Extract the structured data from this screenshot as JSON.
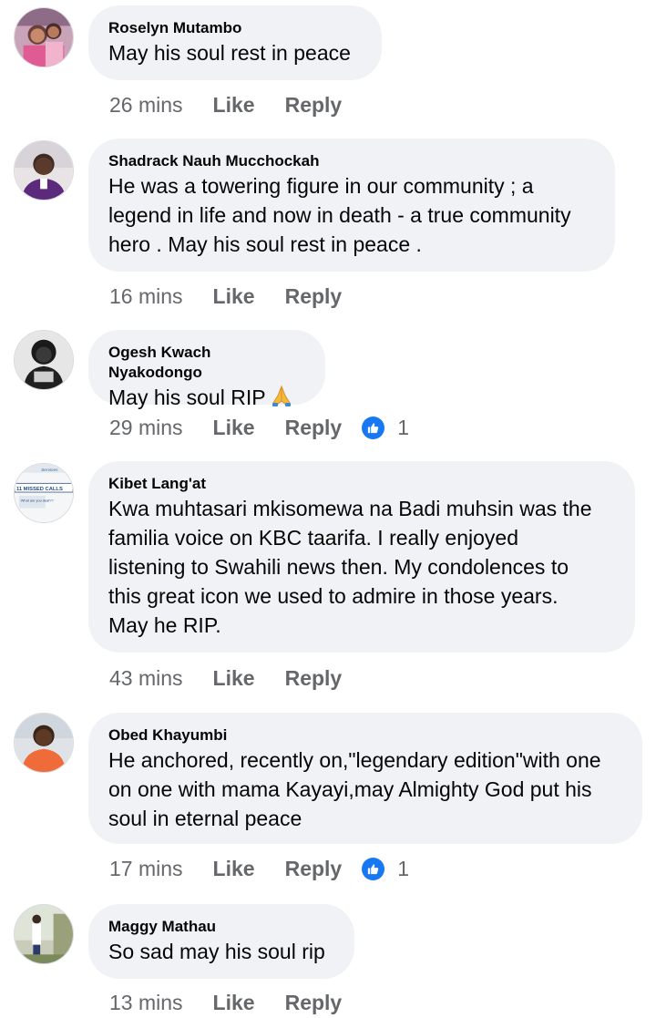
{
  "colors": {
    "bubble_bg": "#f0f2f5",
    "meta_text": "#65676b",
    "like_badge": "#1877f2",
    "text": "#050505"
  },
  "labels": {
    "like": "Like",
    "reply": "Reply"
  },
  "comments": [
    {
      "author": "Roselyn Mutambo",
      "lines": [
        "May his soul rest in peace"
      ],
      "time": "26 mins",
      "reactions": null
    },
    {
      "author": "Shadrack Nauh Mucchockah",
      "lines": [
        "He was a towering figure in our community ; a",
        "legend in life and now in death - a true community",
        "hero . May his soul rest in peace ."
      ],
      "time": "16 mins",
      "reactions": null
    },
    {
      "author": "Ogesh Kwach Nyakodongo",
      "lines": [
        "May his soul RIP"
      ],
      "emoji": "folded-hands-icon",
      "time": "29 mins",
      "reactions": "1"
    },
    {
      "author": "Kibet Lang'at",
      "lines": [
        "Kwa muhtasari mkisomewa na Badi muhsin was the",
        "familia voice on KBC taarifa. I really enjoyed",
        "listening to Swahili news then. My condolences to",
        "this great icon we used to admire in those years.",
        "May he RIP."
      ],
      "avatar_text": {
        "top": "Services",
        "middle": "11 MISSED CALLS",
        "bottom": "What are you deaf??"
      },
      "time": "43 mins",
      "reactions": null
    },
    {
      "author": "Obed Khayumbi",
      "lines": [
        "He anchored, recently on,\"legendary edition\"with one",
        "on one with mama Kayayi,may Almighty God put his",
        "soul in eternal peace"
      ],
      "time": "17 mins",
      "reactions": "1"
    },
    {
      "author": "Maggy Mathau",
      "lines": [
        "So sad may his soul rip"
      ],
      "time": "13 mins",
      "reactions": null
    }
  ]
}
